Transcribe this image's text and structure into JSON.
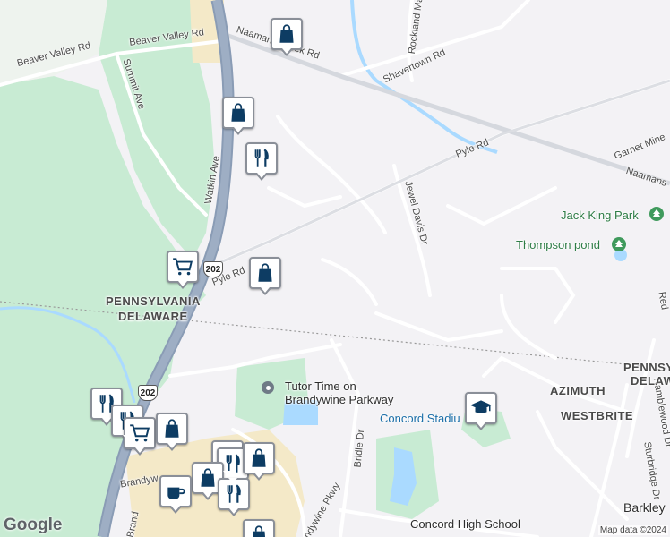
{
  "map": {
    "brand": "Google",
    "attribution": "Map data ©2024",
    "colors": {
      "land": "#f3f2f5",
      "park": "#c8ebd3",
      "water": "#aadaff",
      "highway": "#8a9cb5",
      "road": "#ffffff",
      "pin_border": "#8a8f98",
      "icon": "#0d3c63"
    }
  },
  "roads": {
    "beaver_valley_1": "Beaver Valley Rd",
    "beaver_valley_2": "Beaver Valley Rd",
    "naamans_creek": "Naamans Creek Rd",
    "shavertown": "Shavertown Rd",
    "rockland_mail": "Rockland Mail",
    "summit": "Summit Ave",
    "watkin": "Watkin Ave",
    "pyle_1": "Pyle Rd",
    "pyle_2": "Pyle Rd",
    "garnet_mine": "Garnet Mine",
    "naamans": "Naamans",
    "jewel_davis": "Jewel Davis Dr",
    "bridle": "Bridle Dr",
    "brandywine_pkwy": "Brandywine Pkwy",
    "brandywine_short": "Brandyw",
    "brand_short": "Brand",
    "ramblewood": "Ramblewood Dr",
    "sturbridge": "Sturbridge Dr",
    "red_partial": "Red"
  },
  "areas": {
    "pennsylvania_w": "PENNSYLVANIA",
    "delaware_w": "DELAWARE",
    "pennsylvania_e": "PENNSYLV",
    "delaware_e": "DELAW",
    "azimuth": "AZIMUTH",
    "westbrite": "WESTBRITE",
    "barkley": "Barkley"
  },
  "places": {
    "jack_king_park": "Jack King Park",
    "thompson_pond": "Thompson pond",
    "tutor_time": "Tutor Time on",
    "tutor_time_2": "Brandywine Parkway",
    "concord_stadium": "Concord Stadiu",
    "concord_hs": "Concord High School"
  },
  "shields": {
    "us202_a": "202",
    "us202_b": "202"
  },
  "pins": [
    {
      "type": "shopping-bag"
    },
    {
      "type": "shopping-bag"
    },
    {
      "type": "restaurant"
    },
    {
      "type": "shopping-cart"
    },
    {
      "type": "shopping-bag"
    },
    {
      "type": "restaurant"
    },
    {
      "type": "restaurant"
    },
    {
      "type": "shopping-cart"
    },
    {
      "type": "shopping-bag"
    },
    {
      "type": "shopping-bag"
    },
    {
      "type": "restaurant"
    },
    {
      "type": "shopping-bag"
    },
    {
      "type": "shopping-bag"
    },
    {
      "type": "cafe"
    },
    {
      "type": "restaurant"
    },
    {
      "type": "shopping-bag"
    },
    {
      "type": "school"
    }
  ]
}
